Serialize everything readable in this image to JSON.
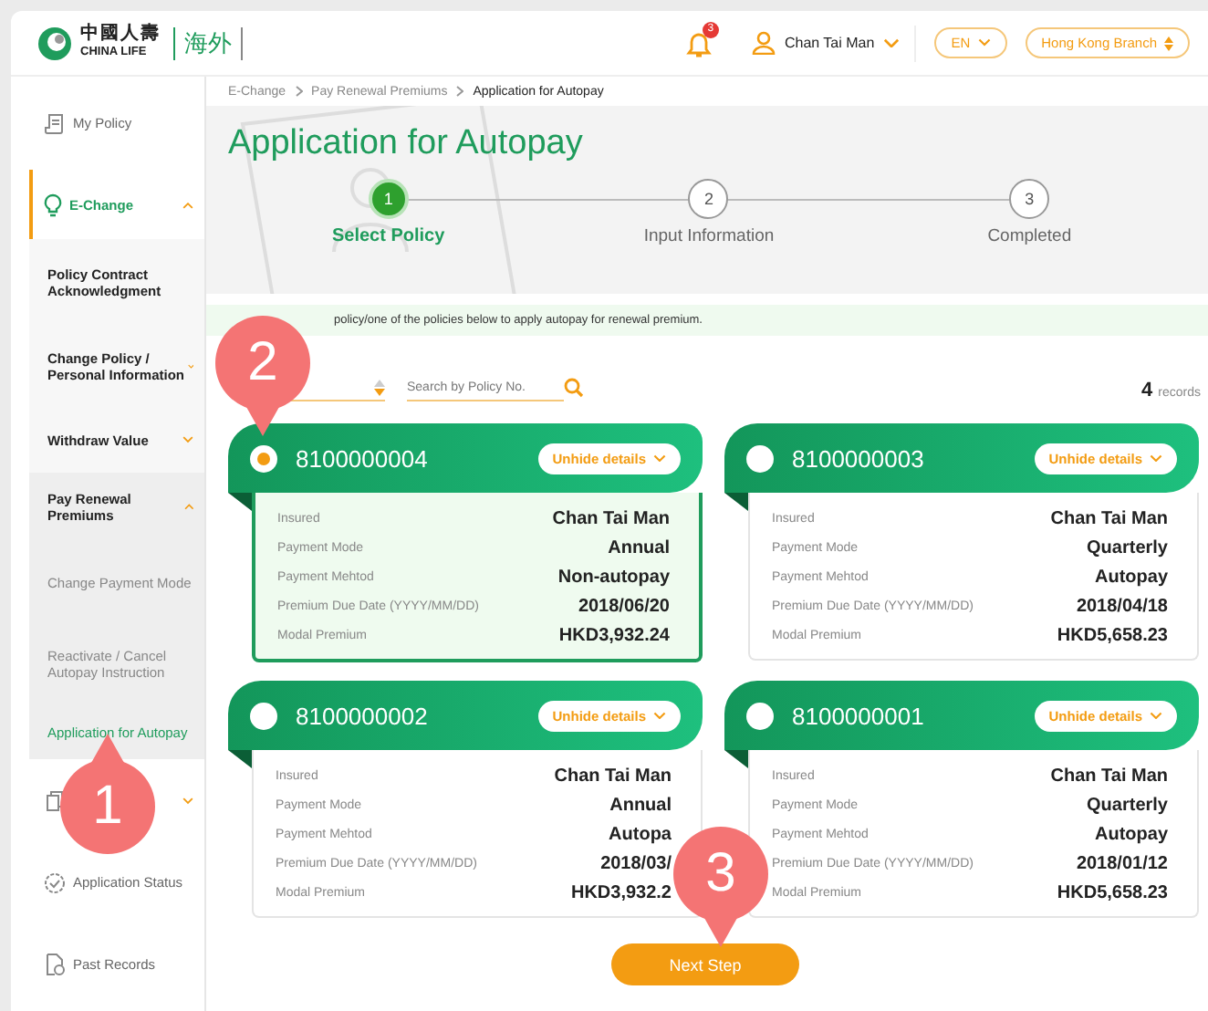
{
  "header": {
    "logo_cn": "中國人壽",
    "logo_en": "CHINA LIFE",
    "logo_tag": "海外",
    "notification_count": "3",
    "user": "Chan Tai Man",
    "language": "EN",
    "branch": "Hong Kong Branch"
  },
  "sidebar": [
    {
      "label": "My Policy"
    },
    {
      "label": "E-Change",
      "expanded": true,
      "children": [
        {
          "label": "Policy Contract Acknowledgment"
        },
        {
          "label": "Change Policy / Personal Information",
          "expanded": false
        },
        {
          "label": "Withdraw Value",
          "expanded": false
        },
        {
          "label": "Pay Renewal Premiums",
          "expanded": true,
          "children": [
            {
              "label": "Change Payment Mode",
              "selected": false
            },
            {
              "label": "Reactivate / Cancel Autopay Instruction",
              "selected": false
            },
            {
              "label": "Application for Autopay",
              "selected": true
            }
          ]
        }
      ]
    },
    {
      "expanded": false
    },
    {
      "label": "Application Status"
    },
    {
      "label": "Past Records"
    }
  ],
  "breadcrumb": [
    "E-Change",
    "Pay Renewal Premiums",
    "Application for Autopay"
  ],
  "title": "Application for Autopay",
  "steps": [
    {
      "number": "1",
      "label": "Select Policy",
      "selected": true
    },
    {
      "number": "2",
      "label": "Input Information",
      "selected": false
    },
    {
      "number": "3",
      "label": "Completed",
      "selected": false
    }
  ],
  "notice": "policy/one of the policies below to apply autopay for renewal premium.",
  "search": {
    "placeholder": "Search by Policy No."
  },
  "records": {
    "count": "4",
    "label": "records"
  },
  "policies": [
    {
      "number": "8100000004",
      "selected": true,
      "details_button": "Unhide details",
      "fields": [
        {
          "label": "Insured",
          "value": "Chan Tai Man"
        },
        {
          "label": "Payment Mode",
          "value": "Annual"
        },
        {
          "label": "Payment Mehtod",
          "value": "Non-autopay"
        },
        {
          "label": "Premium Due Date (YYYY/MM/DD)",
          "value": "2018/06/20"
        },
        {
          "label": "Modal Premium",
          "value": "HKD3,932.24"
        }
      ]
    },
    {
      "number": "8100000003",
      "selected": false,
      "details_button": "Unhide details",
      "fields": [
        {
          "label": "Insured",
          "value": "Chan Tai Man"
        },
        {
          "label": "Payment Mode",
          "value": "Quarterly"
        },
        {
          "label": "Payment Mehtod",
          "value": "Autopay"
        },
        {
          "label": "Premium Due Date (YYYY/MM/DD)",
          "value": "2018/04/18"
        },
        {
          "label": "Modal Premium",
          "value": "HKD5,658.23"
        }
      ]
    },
    {
      "number": "8100000002",
      "selected": false,
      "details_button": "Unhide details",
      "fields": [
        {
          "label": "Insured",
          "value": "Chan Tai Man"
        },
        {
          "label": "Payment Mode",
          "value": "Annual"
        },
        {
          "label": "Payment Mehtod",
          "value": "Autopa"
        },
        {
          "label": "Premium Due Date (YYYY/MM/DD)",
          "value": "2018/03/"
        },
        {
          "label": "Modal Premium",
          "value": "HKD3,932.2"
        }
      ]
    },
    {
      "number": "8100000001",
      "selected": false,
      "details_button": "Unhide details",
      "fields": [
        {
          "label": "Insured",
          "value": "Chan Tai Man"
        },
        {
          "label": "Payment Mode",
          "value": "Quarterly"
        },
        {
          "label": "Payment Mehtod",
          "value": "Autopay"
        },
        {
          "label": "Premium Due Date (YYYY/MM/DD)",
          "value": "2018/01/12"
        },
        {
          "label": "Modal Premium",
          "value": "HKD5,658.23"
        }
      ]
    }
  ],
  "next_button": "Next Step",
  "callouts": [
    "1",
    "2",
    "3"
  ]
}
